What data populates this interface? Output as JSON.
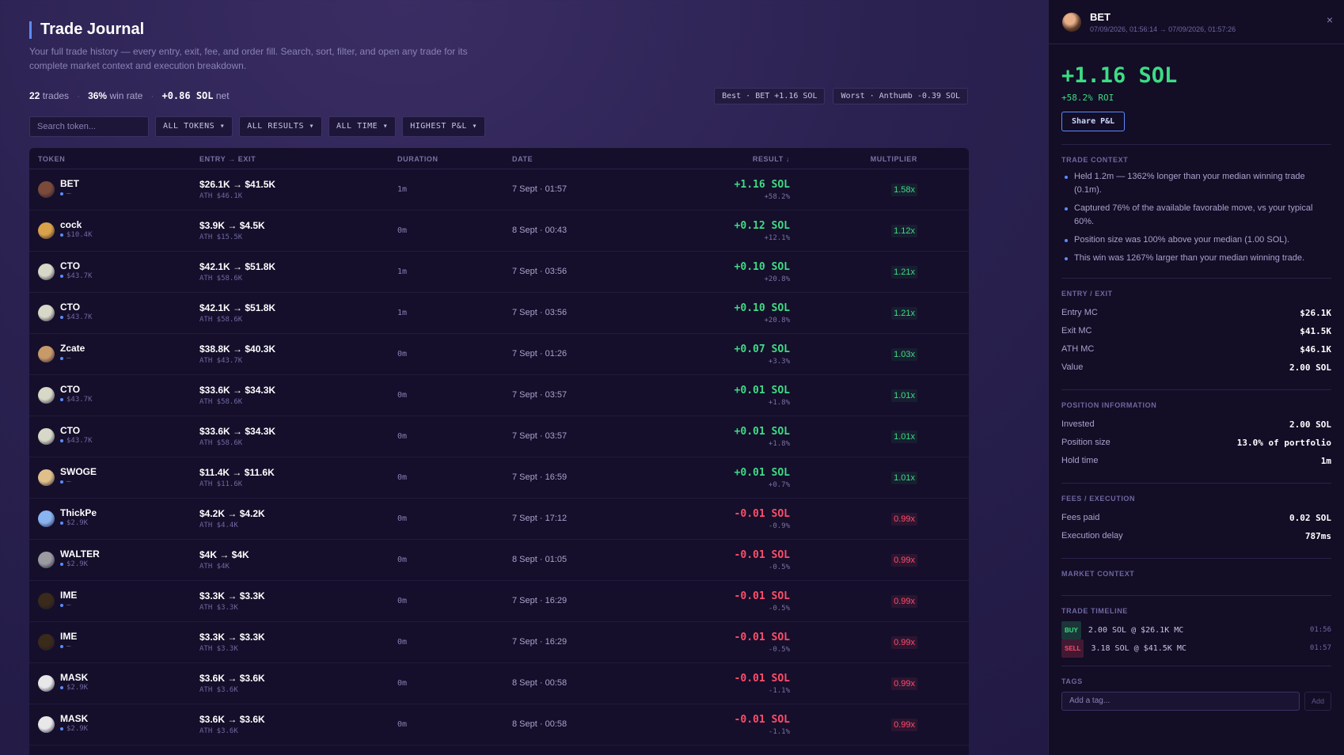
{
  "header": {
    "title": "Trade Journal",
    "subtitle": "Your full trade history — every entry, exit, fee, and order fill. Search, sort, filter, and open any trade for its complete market context and execution breakdown."
  },
  "stats": {
    "trades": "22",
    "trades_label": "trades",
    "winrate": "36%",
    "winrate_label": "win rate",
    "net": "+0.86 SOL",
    "net_label": "net"
  },
  "best_pill": "Best · BET +1.16 SOL",
  "worst_pill": "Worst · Anthumb -0.39 SOL",
  "filters": {
    "search_placeholder": "Search token...",
    "tokens": "ALL TOKENS ▾",
    "results": "ALL RESULTS ▾",
    "time": "ALL TIME ▾",
    "sort": "HIGHEST P&L ▾"
  },
  "columns": {
    "token": "TOKEN",
    "entry": "ENTRY → EXIT",
    "duration": "DURATION",
    "date": "DATE",
    "result": "RESULT ↓",
    "multiplier": "MULTIPLIER"
  },
  "rows": [
    {
      "name": "BET",
      "mc": "—",
      "entry": "$26.1K → $41.5K",
      "ath": "ATH $46.1K",
      "dur": "1m",
      "date": "7 Sept · 01:57",
      "sol": "+1.16 SOL",
      "pct": "+58.2%",
      "mult": "1.58x",
      "positive": true,
      "avatar": "#7a4a3a"
    },
    {
      "name": "cock",
      "mc": "$10.4K",
      "entry": "$3.9K → $4.5K",
      "ath": "ATH $15.5K",
      "dur": "0m",
      "date": "8 Sept · 00:43",
      "sol": "+0.12 SOL",
      "pct": "+12.1%",
      "mult": "1.12x",
      "positive": true,
      "avatar": "#d9a24a"
    },
    {
      "name": "CTO",
      "mc": "$43.7K",
      "entry": "$42.1K → $51.8K",
      "ath": "ATH $58.6K",
      "dur": "1m",
      "date": "7 Sept · 03:56",
      "sol": "+0.10 SOL",
      "pct": "+20.8%",
      "mult": "1.21x",
      "positive": true,
      "avatar": "#d8d8c8"
    },
    {
      "name": "CTO",
      "mc": "$43.7K",
      "entry": "$42.1K → $51.8K",
      "ath": "ATH $58.6K",
      "dur": "1m",
      "date": "7 Sept · 03:56",
      "sol": "+0.10 SOL",
      "pct": "+20.8%",
      "mult": "1.21x",
      "positive": true,
      "avatar": "#d8d8c8"
    },
    {
      "name": "Zcate",
      "mc": "—",
      "entry": "$38.8K → $40.3K",
      "ath": "ATH $43.7K",
      "dur": "0m",
      "date": "7 Sept · 01:26",
      "sol": "+0.07 SOL",
      "pct": "+3.3%",
      "mult": "1.03x",
      "positive": true,
      "avatar": "#c89a6a"
    },
    {
      "name": "CTO",
      "mc": "$43.7K",
      "entry": "$33.6K → $34.3K",
      "ath": "ATH $58.6K",
      "dur": "0m",
      "date": "7 Sept · 03:57",
      "sol": "+0.01 SOL",
      "pct": "+1.8%",
      "mult": "1.01x",
      "positive": true,
      "avatar": "#d8d8c8"
    },
    {
      "name": "CTO",
      "mc": "$43.7K",
      "entry": "$33.6K → $34.3K",
      "ath": "ATH $58.6K",
      "dur": "0m",
      "date": "7 Sept · 03:57",
      "sol": "+0.01 SOL",
      "pct": "+1.8%",
      "mult": "1.01x",
      "positive": true,
      "avatar": "#d8d8c8"
    },
    {
      "name": "SWOGE",
      "mc": "—",
      "entry": "$11.4K → $11.6K",
      "ath": "ATH $11.6K",
      "dur": "0m",
      "date": "7 Sept · 16:59",
      "sol": "+0.01 SOL",
      "pct": "+0.7%",
      "mult": "1.01x",
      "positive": true,
      "avatar": "#e0c08a"
    },
    {
      "name": "ThickPe",
      "mc": "$2.9K",
      "entry": "$4.2K → $4.2K",
      "ath": "ATH $4.4K",
      "dur": "0m",
      "date": "7 Sept · 17:12",
      "sol": "-0.01 SOL",
      "pct": "-0.9%",
      "mult": "0.99x",
      "positive": false,
      "avatar": "#8ab4f0"
    },
    {
      "name": "WALTER",
      "mc": "$2.9K",
      "entry": "$4K → $4K",
      "ath": "ATH $4K",
      "dur": "0m",
      "date": "8 Sept · 01:05",
      "sol": "-0.01 SOL",
      "pct": "-0.5%",
      "mult": "0.99x",
      "positive": false,
      "avatar": "#9a9aa0"
    },
    {
      "name": "IME",
      "mc": "—",
      "entry": "$3.3K → $3.3K",
      "ath": "ATH $3.3K",
      "dur": "0m",
      "date": "7 Sept · 16:29",
      "sol": "-0.01 SOL",
      "pct": "-0.5%",
      "mult": "0.99x",
      "positive": false,
      "avatar": "#3a2a1a"
    },
    {
      "name": "IME",
      "mc": "—",
      "entry": "$3.3K → $3.3K",
      "ath": "ATH $3.3K",
      "dur": "0m",
      "date": "7 Sept · 16:29",
      "sol": "-0.01 SOL",
      "pct": "-0.5%",
      "mult": "0.99x",
      "positive": false,
      "avatar": "#3a2a1a"
    },
    {
      "name": "MASK",
      "mc": "$2.9K",
      "entry": "$3.6K → $3.6K",
      "ath": "ATH $3.6K",
      "dur": "0m",
      "date": "8 Sept · 00:58",
      "sol": "-0.01 SOL",
      "pct": "-1.1%",
      "mult": "0.99x",
      "positive": false,
      "avatar": "#e8e8ea"
    },
    {
      "name": "MASK",
      "mc": "$2.9K",
      "entry": "$3.6K → $3.6K",
      "ath": "ATH $3.6K",
      "dur": "0m",
      "date": "8 Sept · 00:58",
      "sol": "-0.01 SOL",
      "pct": "-1.1%",
      "mult": "0.99x",
      "positive": false,
      "avatar": "#e8e8ea"
    }
  ],
  "panel": {
    "name": "BET",
    "date": "07/09/2026, 01:56:14 → 07/09/2026, 01:57:26",
    "close": "×",
    "pnl": "+1.16 SOL",
    "roi": "+58.2% ROI",
    "share": "Share P&L",
    "context_title": "TRADE CONTEXT",
    "context": [
      "Held 1.2m — 1362% longer than your median winning trade (0.1m).",
      "Captured 76% of the available favorable move, vs your typical 60%.",
      "Position size was 100% above your median (1.00 SOL).",
      "This win was 1267% larger than your median winning trade."
    ],
    "entry_title": "ENTRY / EXIT",
    "entry_rows": [
      {
        "k": "Entry MC",
        "v": "$26.1K"
      },
      {
        "k": "Exit MC",
        "v": "$41.5K"
      },
      {
        "k": "ATH MC",
        "v": "$46.1K"
      },
      {
        "k": "Value",
        "v": "2.00 SOL"
      }
    ],
    "position_title": "POSITION INFORMATION",
    "position_rows": [
      {
        "k": "Invested",
        "v": "2.00 SOL"
      },
      {
        "k": "Position size",
        "v": "13.0% of portfolio"
      },
      {
        "k": "Hold time",
        "v": "1m"
      }
    ],
    "fees_title": "FEES / EXECUTION",
    "fees_rows": [
      {
        "k": "Fees paid",
        "v": "0.02 SOL"
      },
      {
        "k": "Execution delay",
        "v": "787ms"
      }
    ],
    "market_title": "MARKET CONTEXT",
    "timeline_title": "TRADE TIMELINE",
    "timeline": [
      {
        "tag": "BUY",
        "text": "2.00 SOL @ $26.1K MC",
        "time": "01:56"
      },
      {
        "tag": "SELL",
        "text": "3.18 SOL @ $41.5K MC",
        "time": "01:57"
      }
    ],
    "tags_title": "TAGS",
    "tag_placeholder": "Add a tag...",
    "tag_add": "Add"
  }
}
